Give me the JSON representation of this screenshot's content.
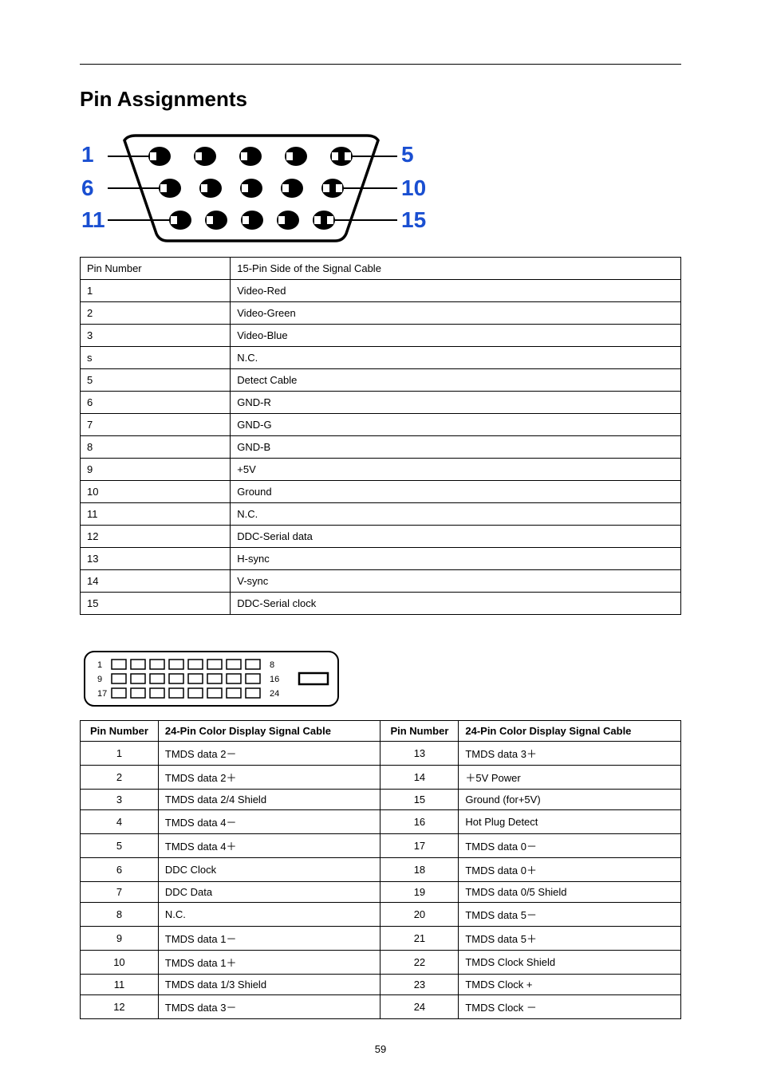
{
  "title": "Pin Assignments",
  "page_number": "59",
  "vga_labels": {
    "l1": "1",
    "r1": "5",
    "l2": "6",
    "r2": "10",
    "l3": "11",
    "r3": "15"
  },
  "dvi_labels": {
    "l1": "1",
    "r1": "8",
    "l2": "9",
    "r2": "16",
    "l3": "17",
    "r3": "24"
  },
  "table15": {
    "header": {
      "pin": "Pin Number",
      "desc": "15-Pin Side of the Signal Cable"
    },
    "rows": [
      {
        "pin": "1",
        "desc": "Video-Red"
      },
      {
        "pin": "2",
        "desc": "Video-Green"
      },
      {
        "pin": "3",
        "desc": "Video-Blue"
      },
      {
        "pin": "s",
        "desc": "N.C."
      },
      {
        "pin": "5",
        "desc": "Detect Cable"
      },
      {
        "pin": "6",
        "desc": "GND-R"
      },
      {
        "pin": "7",
        "desc": "GND-G"
      },
      {
        "pin": "8",
        "desc": "GND-B"
      },
      {
        "pin": "9",
        "desc": "+5V"
      },
      {
        "pin": "10",
        "desc": "Ground"
      },
      {
        "pin": "11",
        "desc": "N.C."
      },
      {
        "pin": "12",
        "desc": "DDC-Serial data"
      },
      {
        "pin": "13",
        "desc": "H-sync"
      },
      {
        "pin": "14",
        "desc": "V-sync"
      },
      {
        "pin": "15",
        "desc": "DDC-Serial clock"
      }
    ]
  },
  "table24": {
    "header": {
      "pin": "Pin Number",
      "desc": "24-Pin Color Display Signal Cable"
    },
    "rows": [
      {
        "pin1": "1",
        "desc1": "TMDS data 2－",
        "pin2": "13",
        "desc2": "TMDS data 3＋"
      },
      {
        "pin1": "2",
        "desc1": "TMDS data 2＋",
        "pin2": "14",
        "desc2": "＋5V Power"
      },
      {
        "pin1": "3",
        "desc1": "TMDS data 2/4 Shield",
        "pin2": "15",
        "desc2": "Ground (for+5V)"
      },
      {
        "pin1": "4",
        "desc1": "TMDS data 4－",
        "pin2": "16",
        "desc2": "Hot Plug Detect"
      },
      {
        "pin1": "5",
        "desc1": "TMDS data 4＋",
        "pin2": "17",
        "desc2": "TMDS data 0－"
      },
      {
        "pin1": "6",
        "desc1": "DDC Clock",
        "pin2": "18",
        "desc2": "TMDS data 0＋"
      },
      {
        "pin1": "7",
        "desc1": "DDC Data",
        "pin2": "19",
        "desc2": "TMDS data 0/5 Shield"
      },
      {
        "pin1": "8",
        "desc1": "N.C.",
        "pin2": "20",
        "desc2": "TMDS data 5－"
      },
      {
        "pin1": "9",
        "desc1": "TMDS data 1－",
        "pin2": "21",
        "desc2": "TMDS data 5＋"
      },
      {
        "pin1": "10",
        "desc1": "TMDS data 1＋",
        "pin2": "22",
        "desc2": "TMDS Clock Shield"
      },
      {
        "pin1": "11",
        "desc1": "TMDS data 1/3 Shield",
        "pin2": "23",
        "desc2": "TMDS Clock +"
      },
      {
        "pin1": "12",
        "desc1": "TMDS data 3－",
        "pin2": "24",
        "desc2": "TMDS Clock －"
      }
    ]
  }
}
